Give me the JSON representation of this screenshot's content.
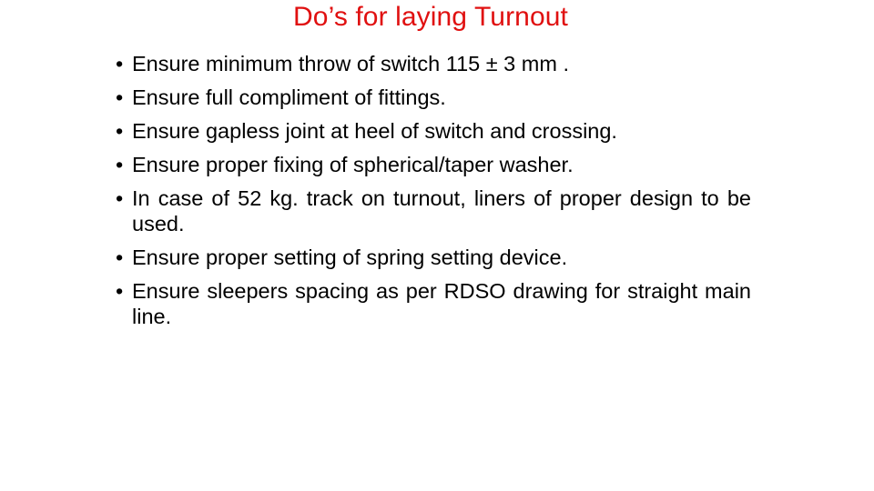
{
  "slide": {
    "title": "Do’s for laying Turnout",
    "title_color": "#e01010",
    "bullet_glyph": "•",
    "bullets": [
      "Ensure minimum throw of switch 115 ± 3 mm .",
      "Ensure full compliment of fittings.",
      "Ensure gapless joint at heel of switch and crossing.",
      "Ensure proper fixing of spherical/taper washer.",
      "In case of 52 kg. track on turnout, liners of proper design to be used.",
      "Ensure proper setting of spring setting device.",
      "Ensure sleepers spacing as per RDSO drawing for straight main line."
    ]
  }
}
